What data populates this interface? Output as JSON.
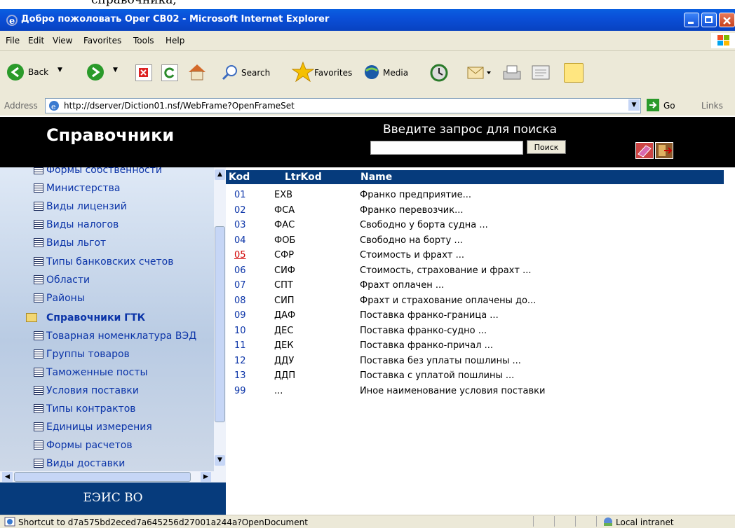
{
  "fragment_text": "справочника;",
  "window": {
    "title": "Добро пожоловать Oper CB02 - Microsoft Internet Explorer"
  },
  "menu": [
    "File",
    "Edit",
    "View",
    "Favorites",
    "Tools",
    "Help"
  ],
  "toolbar": {
    "back": "Back",
    "search": "Search",
    "favorites": "Favorites",
    "media": "Media"
  },
  "address": {
    "label": "Address",
    "url": "http://dserver/Diction01.nsf/WebFrame?OpenFrameSet",
    "go": "Go",
    "links": "Links"
  },
  "header": {
    "title": "Справочники",
    "search_prompt": "Введите запрос для поиска",
    "search_button": "Поиск"
  },
  "nav": {
    "items_top": [
      "Формы собственности",
      "Министерства",
      "Виды лицензий",
      "Виды налогов",
      "Виды льгот",
      "Типы банковских счетов",
      "Области",
      "Районы"
    ],
    "folder": "Справочники ГТК",
    "items_sub": [
      "Товарная номенклатура ВЭД",
      "Группы товаров",
      "Таможенные посты",
      "Условия поставки",
      "Типы контрактов",
      "Единицы измерения",
      "Формы расчетов",
      "Виды доставки"
    ],
    "brand": "ЕЭИС ВО"
  },
  "table": {
    "columns": [
      "Kod",
      "LtrKod",
      "Name"
    ],
    "rows": [
      {
        "kod": "01",
        "ltr": "EXB",
        "name": "Франко предприятие..."
      },
      {
        "kod": "02",
        "ltr": "ФСА",
        "name": "Франко перевозчик..."
      },
      {
        "kod": "03",
        "ltr": "ФАС",
        "name": "Свободно у борта судна ..."
      },
      {
        "kod": "04",
        "ltr": "ФОБ",
        "name": "Свободно на борту ..."
      },
      {
        "kod": "05",
        "ltr": "СФР",
        "name": "Стоимость и фрахт ..."
      },
      {
        "kod": "06",
        "ltr": "СИФ",
        "name": "Стоимость, страхование и фрахт ..."
      },
      {
        "kod": "07",
        "ltr": "СПТ",
        "name": "Фрахт оплачен ..."
      },
      {
        "kod": "08",
        "ltr": "СИП",
        "name": "Фрахт и страхование оплачены до..."
      },
      {
        "kod": "09",
        "ltr": "ДАФ",
        "name": "Поставка франко-граница ..."
      },
      {
        "kod": "10",
        "ltr": "ДЕС",
        "name": "Поставка франко-судно ..."
      },
      {
        "kod": "11",
        "ltr": "ДЕК",
        "name": "Поставка франко-причал ..."
      },
      {
        "kod": "12",
        "ltr": "ДДУ",
        "name": "Поставка без уплаты пошлины ..."
      },
      {
        "kod": "13",
        "ltr": "ДДП",
        "name": "Поставка с уплатой пошлины ..."
      },
      {
        "kod": "99",
        "ltr": "...",
        "name": "Иное наименование условия поставки"
      }
    ]
  },
  "status": {
    "text": "Shortcut to d7a575bd2eced7a645256d27001a244a?OpenDocument",
    "zone": "Local intranet"
  }
}
